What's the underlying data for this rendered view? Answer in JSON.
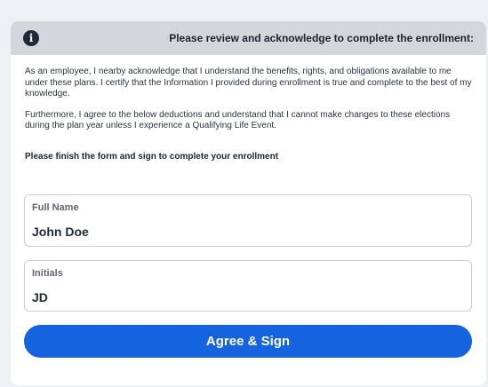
{
  "header": {
    "icon": "info-icon",
    "title": "Please review and acknowledge to complete the enrollment:"
  },
  "body": {
    "paragraph1": "As an employee, I nearby acknowledge that I understand the benefits, rights, and obligations available to me under these plans. I certify that the Information I provided during enrollment is true and complete to the best of my knowledge.",
    "paragraph2": "Furthermore, I agree to the below deductions and understand that I cannot make changes to these elections during the plan year unless I experience a Qualifying Life Event.",
    "instruction": "Please finish the form and sign to complete your enrollment"
  },
  "form": {
    "full_name": {
      "label": "Full Name",
      "value": "John Doe"
    },
    "initials": {
      "label": "Initials",
      "value": "JD"
    }
  },
  "actions": {
    "agree_label": "Agree & Sign"
  },
  "colors": {
    "header_bg": "#d3d6da",
    "accent": "#1663e0",
    "page_bg": "#eef0f3"
  }
}
